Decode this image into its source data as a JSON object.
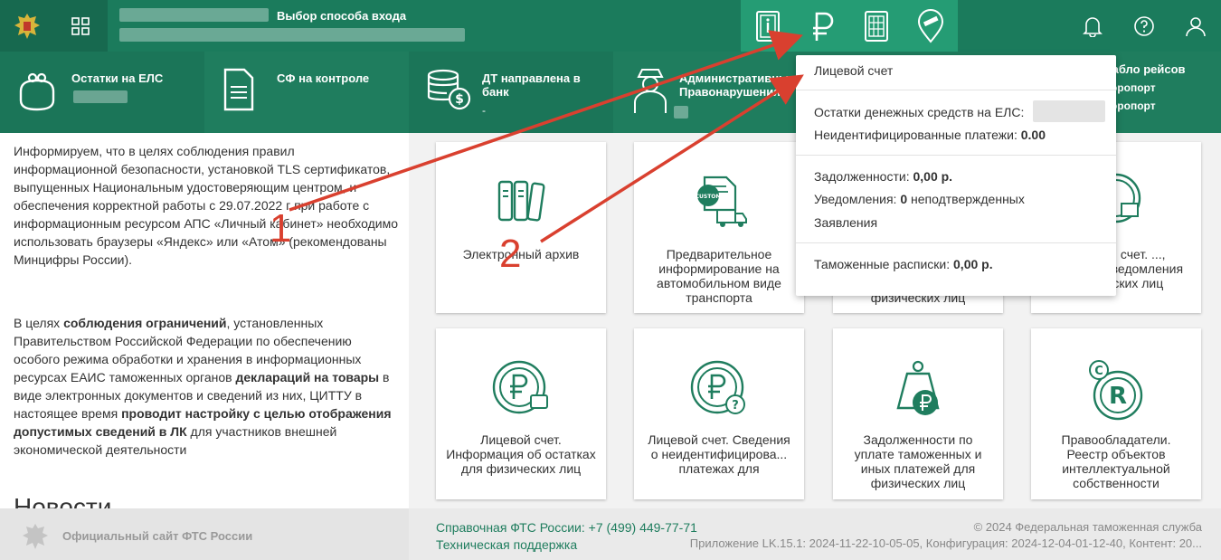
{
  "header": {
    "title": "Выбор способа входа",
    "icons": [
      "document-icon",
      "ruble-icon",
      "calculator-icon",
      "location-barrier-icon"
    ],
    "right_icons": [
      "bell-icon",
      "help-icon",
      "user-icon"
    ]
  },
  "stats": [
    {
      "label": "Остатки на ЕЛС",
      "value": ""
    },
    {
      "label": "СФ на контроле",
      "value": ""
    },
    {
      "label": "ДТ направлена в банк",
      "value": "-"
    },
    {
      "label": "Административные Правонарушения",
      "value": ""
    },
    {
      "label": "Табло рейсов",
      "value": ""
    }
  ],
  "stats_extra": {
    "line1": "аэропорт",
    "line2": "аэропорт"
  },
  "info": {
    "para1": "Информируем, что в целях соблюдения правил информационной безопасности, установкой TLS сертификатов, выпущенных Национальным удостоверяющим центром, и обеспечения корректной работы с 29.07.2022 г при работе с информационным ресурсом АПС «Личный кабинет» необходимо использовать браузеры «Яндекс» или «Атом» (рекомендованы Минцифры России).",
    "para2_a": "В целях ",
    "para2_b": "соблюдения ограничений",
    "para2_c": ", установленных Правительством Российской Федерации по обеспечению особого режима обработки и хранения в информационных ресурсах ЕАИС таможенных органов ",
    "para2_d": "деклараций на товары",
    "para2_e": " в виде электронных документов и сведений из них, ЦИТТУ в настоящее время ",
    "para2_f": "проводит настройку с целью отображения допустимых сведений в ЛК",
    "para2_g": " для участников внешней экономической деятельности",
    "news": "Новости"
  },
  "tiles_row1": [
    {
      "label": "Электронный архив"
    },
    {
      "label": "Предварительное информирование на автомобильном виде транспорта"
    },
    {
      "label": "физических лиц"
    },
    {
      "label": "Лицевой счет. ..., выписки, уведомления физических лиц"
    }
  ],
  "tiles_row2": [
    {
      "label": "Лицевой счет. Информация об остатках для физических лиц"
    },
    {
      "label": "Лицевой счет. Сведения о неидентифицирова... платежах для"
    },
    {
      "label": "Задолженности по уплате таможенных и иных платежей для физических лиц"
    },
    {
      "label": "Правообладатели. Реестр объектов интеллектуальной собственности"
    }
  ],
  "dropdown": {
    "title": "Лицевой счет",
    "balance_label": "Остатки денежных средств на ЕЛС:",
    "unid_label": "Неидентифицированные платежи:",
    "unid_value": "0.00",
    "debt_label": "Задолженности:",
    "debt_value": "0,00 р.",
    "notif_label": "Уведомления:",
    "notif_count": "0",
    "notif_suffix": "неподтвержденных",
    "applications": "Заявления",
    "receipts_label": "Таможенные расписки:",
    "receipts_value": "0,00 р."
  },
  "annotations": [
    "1",
    "2"
  ],
  "footer": {
    "official": "Официальный сайт ФТС России",
    "phone": "Справочная ФТС России: +7 (499) 449-77-71",
    "support": "Техническая поддержка",
    "copyright": "© 2024 Федеральная таможенная служба",
    "version": "Приложение LK.15.1: 2024-11-22-10-05-05, Конфигурация: 2024-12-04-01-12-40, Контент: 20..."
  },
  "colors": {
    "primary": "#1b7b5c",
    "accent": "#259c74",
    "arrow": "#d9402f"
  }
}
